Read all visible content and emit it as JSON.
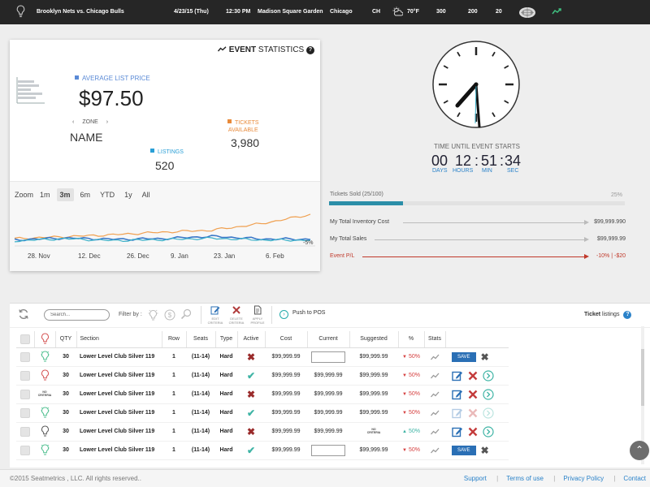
{
  "header": {
    "matchup": "Brooklyn Nets vs. Chicago Bulls",
    "date": "4/23/15 (Thu)",
    "time": "12:30 PM",
    "venue": "Madison Square Garden",
    "city": "Chicago",
    "team_code": "CH",
    "temperature": "70°F",
    "stat_1": "300",
    "stat_2": "200",
    "stat_3": "20"
  },
  "stats": {
    "title_bold": "EVENT",
    "title_rest": " STATISTICS",
    "help": "?",
    "avg_label": "AVERAGE LIST PRICE",
    "avg_value": "$97.50",
    "zone_label": "ZONE",
    "zone_prev": "‹",
    "zone_next": "›",
    "zone_name": "NAME",
    "tickets_label_1": "TICKETS",
    "tickets_label_2": "AVAILABLE",
    "tickets_value": "3,980",
    "listings_label": "LISTINGS",
    "listings_value": "520",
    "zoom_label": "Zoom",
    "zoom_options": [
      "1m",
      "3m",
      "6m",
      "YTD",
      "1y",
      "All"
    ],
    "zoom_selected": "3m",
    "dates": [
      "28. Nov",
      "12. Dec",
      "26. Dec",
      "9. Jan",
      "23. Jan",
      "6. Feb"
    ],
    "y_annotation": "-5%",
    "colors": {
      "orange": "#f0a050",
      "blue": "#3a78c8",
      "teal": "#3ab0c8",
      "accent": "#2a82c9"
    }
  },
  "chart_data": {
    "type": "line",
    "x": [
      "28. Nov",
      "12. Dec",
      "26. Dec",
      "9. Jan",
      "23. Jan",
      "6. Feb"
    ],
    "series": [
      {
        "color": "#f0a050",
        "values": [
          1.0,
          1.6,
          2.2,
          3.0,
          3.6,
          5.6,
          8.4
        ]
      },
      {
        "color": "#3a78c8",
        "values": [
          0.6,
          1.2,
          0.8,
          1.0,
          1.7,
          0.9,
          0.8
        ]
      },
      {
        "color": "#3ab0c8",
        "values": [
          0.3,
          1.0,
          0.4,
          0.7,
          1.1,
          0.6,
          0.5
        ]
      }
    ],
    "annotations": [
      "-5%"
    ],
    "ylim": [
      -1,
      10
    ]
  },
  "countdown": {
    "title": "TIME UNTIL EVENT STARTS",
    "days": "00",
    "hours": "12",
    "minutes": "51",
    "seconds": "34",
    "days_label": "DAYS",
    "hours_label": "HOURS",
    "min_label": "MIN",
    "sec_label": "SEC"
  },
  "progress": {
    "label": "Tickets Sold (25/100)",
    "percent_text": "25%",
    "fraction": 0.25,
    "inventory_label": "My Total Inventory Cost",
    "inventory_value": "$99,999.990",
    "sales_label": "My Total Sales",
    "sales_value": "$99,999.99",
    "pl_label": "Event P/L",
    "pl_value": "-10% | -$20"
  },
  "listings": {
    "search_placeholder": "Search...",
    "filter_label": "Filter by :",
    "edit_label": "EDIT CRITERIA",
    "delete_label": "DELETE CRITERIA",
    "apply_label": "APPLY PROFILE",
    "push_label": "Push to POS",
    "title_bold": "Ticket",
    "title_rest": " listings",
    "help": "?",
    "save_label": "SAVE",
    "no_criteria_1": "NO",
    "no_criteria_2": "CRITERIA",
    "columns": [
      "QTY",
      "Section",
      "Row",
      "Seats",
      "Type",
      "Active",
      "Cost",
      "Current",
      "Suggested",
      "%",
      "Stats"
    ],
    "rows": [
      {
        "bulb": "green",
        "qty": "30",
        "section": "Lower Level Club Silver 119",
        "row": "1",
        "seats": "(11-14)",
        "type": "Hard",
        "active": false,
        "cost": "$99,999.99",
        "current": "",
        "current_is_input": true,
        "suggested": "$99,999.99",
        "pct": "50%",
        "dir": "down",
        "actions": "save"
      },
      {
        "bulb": "red",
        "qty": "30",
        "section": "Lower Level Club Silver 119",
        "row": "1",
        "seats": "(11-14)",
        "type": "Hard",
        "active": true,
        "cost": "$99,999.99",
        "current": "$99,999.99",
        "current_is_input": false,
        "suggested": "$99,999.99",
        "pct": "50%",
        "dir": "down",
        "actions": "edit"
      },
      {
        "bulb": "none",
        "qty": "30",
        "section": "Lower Level Club Silver 119",
        "row": "1",
        "seats": "(11-14)",
        "type": "Hard",
        "active": false,
        "cost": "$99,999.99",
        "current": "$99,999.99",
        "current_is_input": false,
        "suggested": "$99,999.99",
        "pct": "50%",
        "dir": "down",
        "actions": "edit"
      },
      {
        "bulb": "green",
        "qty": "30",
        "section": "Lower Level Club Silver 119",
        "row": "1",
        "seats": "(11-14)",
        "type": "Hard",
        "active": true,
        "cost": "$99,999.99",
        "current": "$99,999.99",
        "current_is_input": false,
        "suggested": "$99,999.99",
        "pct": "50%",
        "dir": "down",
        "actions": "edit-faded"
      },
      {
        "bulb": "grey",
        "qty": "30",
        "section": "Lower Level Club Silver 119",
        "row": "1",
        "seats": "(11-14)",
        "type": "Hard",
        "active": false,
        "cost": "$99,999.99",
        "current": "$99,999.99",
        "current_is_input": false,
        "suggested": "nocrit",
        "pct": "50%",
        "dir": "up",
        "actions": "edit"
      },
      {
        "bulb": "green",
        "qty": "30",
        "section": "Lower Level Club Silver 119",
        "row": "1",
        "seats": "(11-14)",
        "type": "Hard",
        "active": true,
        "cost": "$99,999.99",
        "current": "",
        "current_is_input": true,
        "suggested": "$99,999.99",
        "pct": "50%",
        "dir": "down",
        "actions": "save"
      }
    ]
  },
  "footer": {
    "copyright": "©2015 Seatmetrics , LLC. All rights reserved..",
    "links": [
      "Support",
      "Terms of use",
      "Privacy Policy",
      "Contact"
    ]
  }
}
